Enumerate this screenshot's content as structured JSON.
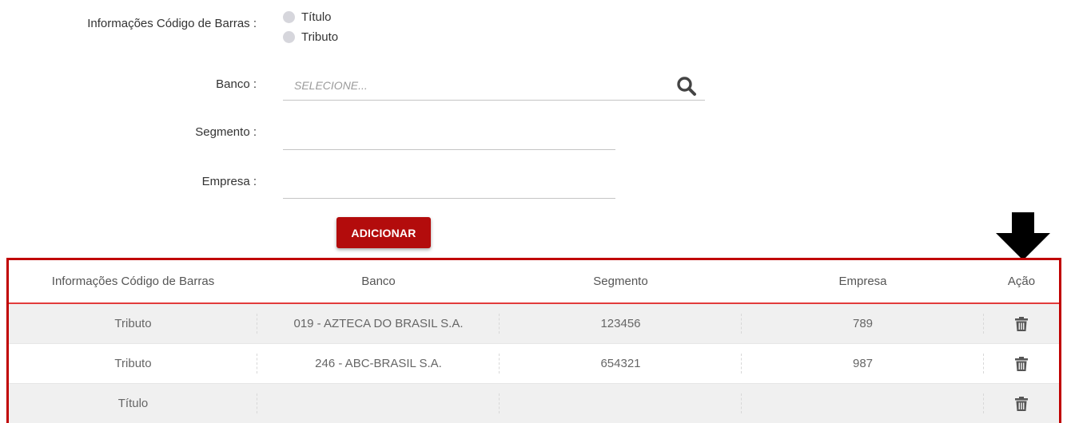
{
  "form": {
    "barcode_label": "Informações Código de Barras :",
    "radio_options": [
      "Título",
      "Tributo"
    ],
    "banco_label": "Banco :",
    "banco_placeholder": "SELECIONE...",
    "segmento_label": "Segmento :",
    "segmento_value": "",
    "empresa_label": "Empresa :",
    "empresa_value": "",
    "add_button_label": "ADICIONAR"
  },
  "table": {
    "headers": [
      "Informações Código de Barras",
      "Banco",
      "Segmento",
      "Empresa",
      "Ação"
    ],
    "rows": [
      {
        "info": "Tributo",
        "banco": "019 - AZTECA DO BRASIL S.A.",
        "segmento": "123456",
        "empresa": "789"
      },
      {
        "info": "Tributo",
        "banco": "246 - ABC-BRASIL S.A.",
        "segmento": "654321",
        "empresa": "987"
      },
      {
        "info": "Título",
        "banco": "",
        "segmento": "",
        "empresa": ""
      }
    ]
  },
  "colors": {
    "accent": "#b30c0c",
    "highlight_border": "#c00000",
    "header_underline": "#e23b3b",
    "row_alt": "#f0f0f0"
  },
  "icons": {
    "search": "search-icon",
    "delete": "trash-icon",
    "annotation": "down-arrow-icon"
  }
}
